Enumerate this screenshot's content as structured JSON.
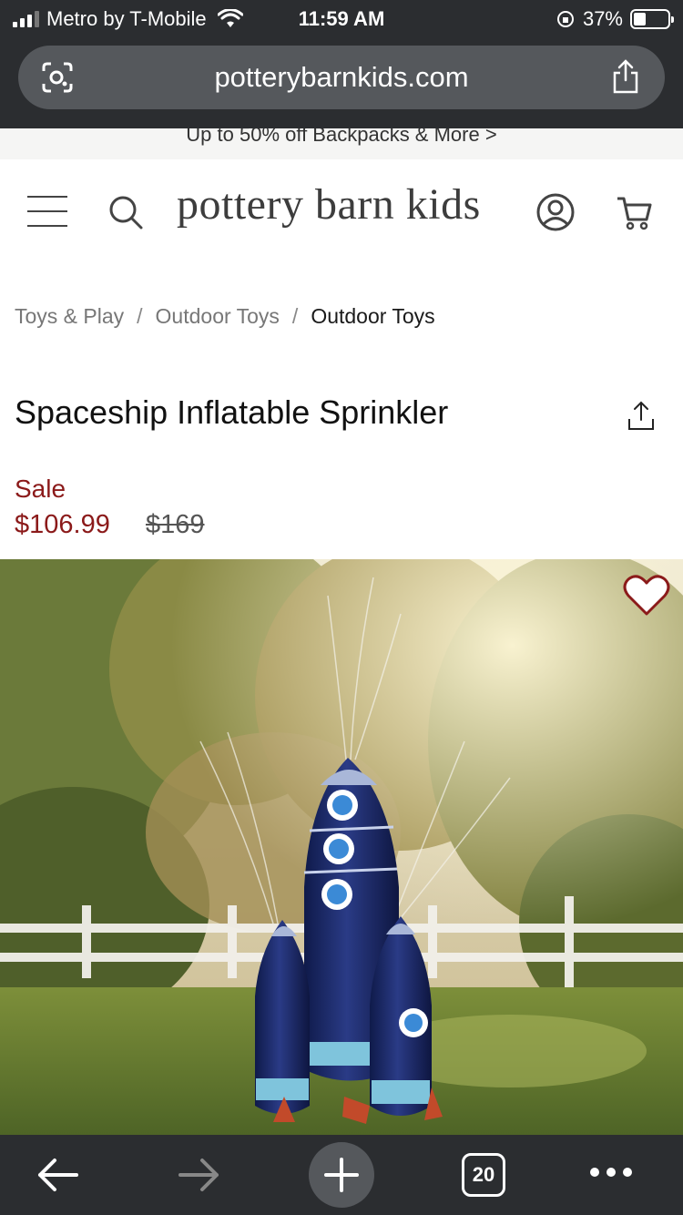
{
  "status_bar": {
    "carrier": "Metro by T-Mobile",
    "time": "11:59 AM",
    "battery": "37%",
    "battery_level": 0.37
  },
  "browser": {
    "url": "potterybarnkids.com",
    "tab_count": "20",
    "icons": [
      "lens-icon",
      "share-icon",
      "back-arrow-icon",
      "forward-arrow-icon",
      "plus-icon",
      "more-icon"
    ]
  },
  "promo": {
    "text": "Up to 50% off Backpacks & More >"
  },
  "header": {
    "logo": "pottery barn kids",
    "icons": [
      "hamburger-menu-icon",
      "search-icon",
      "account-icon",
      "cart-icon"
    ]
  },
  "breadcrumb": {
    "items": [
      "Toys & Play",
      "Outdoor Toys",
      "Outdoor Toys"
    ],
    "separator": "/"
  },
  "product": {
    "title": "Spaceship Inflatable Sprinkler",
    "sale_label": "Sale",
    "sale_price": "$106.99",
    "original_price": "$169"
  },
  "colors": {
    "chrome_bg": "#2b2d30",
    "sale_red": "#8b1a1a",
    "rocket_navy": "#1c2a66"
  }
}
